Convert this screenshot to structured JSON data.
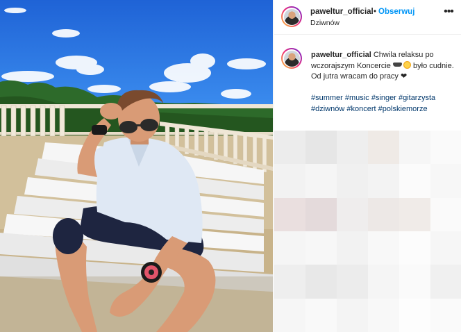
{
  "post": {
    "username": "paweltur_official",
    "separator": "•",
    "follow_label": "Obserwuj",
    "location": "Dziwnów",
    "more_label": "•••",
    "caption": {
      "username": "paweltur_official",
      "text_part1": "Chwila relaksu po wczorajszym Koncercie",
      "text_part2": "było cudnie.",
      "text_part3": "Od jutra wracam do pracy",
      "hashtags": [
        "#summer",
        "#music",
        "#singer",
        "#gitarzysta",
        "#dziwnów",
        "#koncert",
        "#polskiemorze"
      ]
    }
  },
  "colors": {
    "link_blue": "#0095f6",
    "hashtag": "#00376b",
    "text": "#262626",
    "border": "#efefef"
  },
  "icons": {
    "more": "ellipsis-icon",
    "heart": "heart-icon",
    "sun": "sun-emoji-icon",
    "sunglasses": "sunglasses-emoji-icon"
  }
}
